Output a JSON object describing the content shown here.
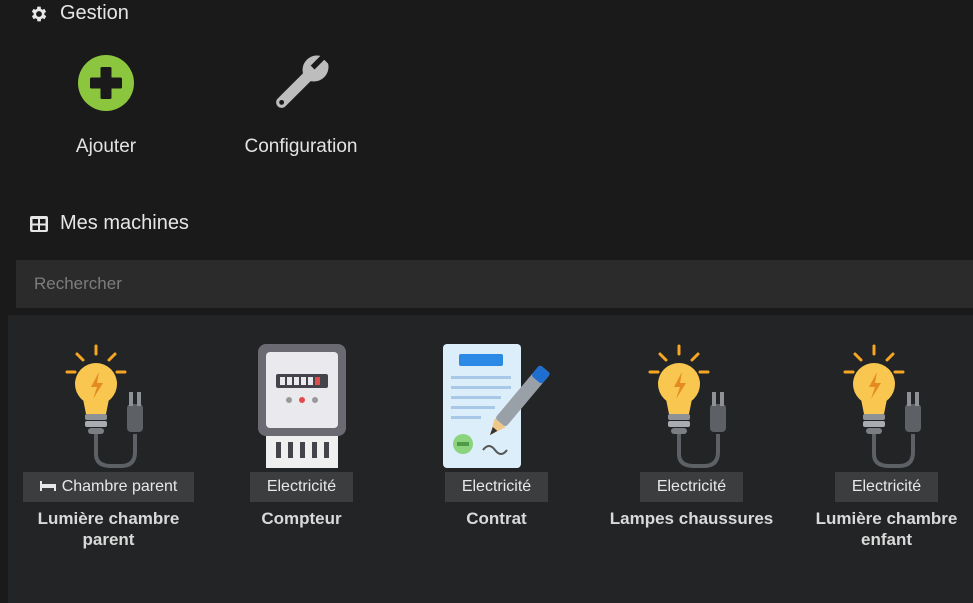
{
  "gestion": {
    "title": "Gestion",
    "actions": [
      {
        "label": "Ajouter",
        "icon": "plus-circle-icon"
      },
      {
        "label": "Configuration",
        "icon": "wrench-icon"
      }
    ]
  },
  "machines": {
    "title": "Mes machines",
    "search_placeholder": "Rechercher",
    "items": [
      {
        "badge": "Chambre parent",
        "badge_icon": "bed-icon",
        "name": "Lumière chambre parent",
        "image": "lightbulb-plug-icon"
      },
      {
        "badge": "Electricité",
        "name": "Compteur",
        "image": "electric-meter-icon"
      },
      {
        "badge": "Electricité",
        "name": "Contrat",
        "image": "contract-pen-icon"
      },
      {
        "badge": "Electricité",
        "name": "Lampes chaussures",
        "image": "lightbulb-plug-icon"
      },
      {
        "badge": "Electricité",
        "name": "Lumière chambre enfant",
        "image": "lightbulb-plug-icon"
      }
    ]
  },
  "colors": {
    "accent_green": "#8cc63f",
    "bulb": "#f6b93b",
    "background": "#1a1a1a"
  }
}
